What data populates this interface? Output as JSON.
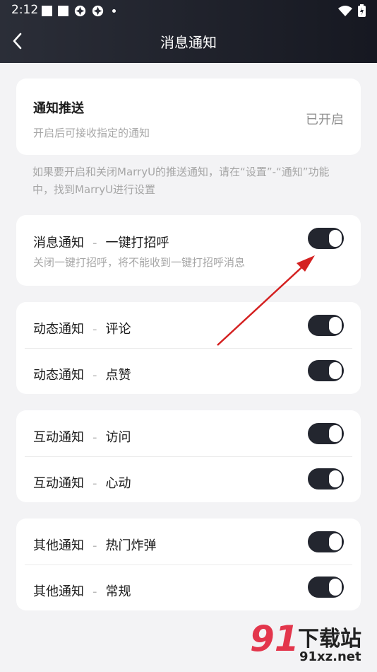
{
  "status_bar": {
    "time": "2:12"
  },
  "header": {
    "title": "消息通知"
  },
  "push": {
    "title": "通知推送",
    "subtitle": "开启后可接收指定的通知",
    "state": "已开启"
  },
  "note": "如果要开启和关闭MarryU的推送通知，请在“设置”-“通知”功能中，找到MarryU进行设置",
  "separator": "-",
  "greeting": {
    "category": "消息通知",
    "item": "一键打招呼",
    "subtitle": "关闭一键打招呼，将不能收到一键打招呼消息"
  },
  "groups": [
    {
      "category": "动态通知",
      "items": [
        "评论",
        "点赞"
      ]
    },
    {
      "category": "互动通知",
      "items": [
        "访问",
        "心动"
      ]
    },
    {
      "category": "其他通知",
      "items": [
        "热门炸弹",
        "常规"
      ]
    }
  ],
  "watermark": {
    "logo": "91",
    "name": "下载站",
    "url": "91xz.net"
  },
  "colors": {
    "toggle_on": "#23262f",
    "arrow": "#d42020",
    "header": "#1c1f28"
  }
}
